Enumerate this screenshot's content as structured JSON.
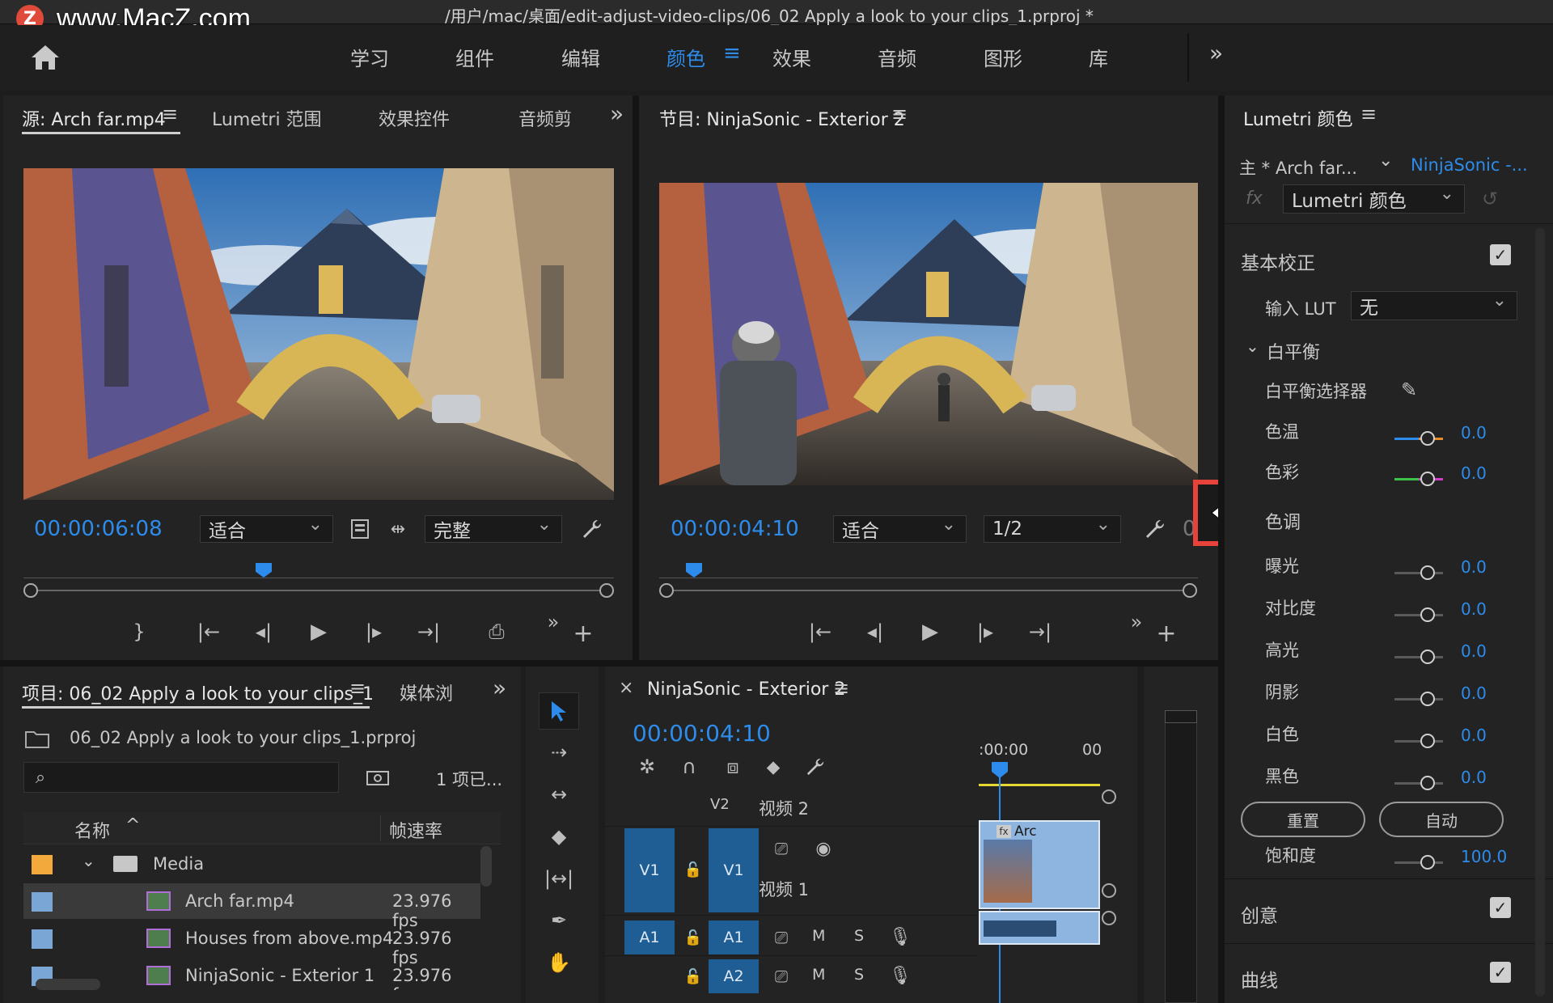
{
  "watermark": "www.MacZ.com",
  "window_title": "/用户/mac/桌面/edit-adjust-video-clips/06_02 Apply a look to your clips_1.prproj *",
  "workspaces": [
    "学习",
    "组件",
    "编辑",
    "颜色",
    "效果",
    "音频",
    "图形",
    "库"
  ],
  "active_workspace": "颜色",
  "source": {
    "tabs": [
      "源: Arch far.mp4",
      "Lumetri 范围",
      "效果控件",
      "音频剪"
    ],
    "timecode": "00:00:06:08",
    "fit": "适合",
    "quality": "完整"
  },
  "program": {
    "title": "节目: NinjaSonic - Exterior 2",
    "timecode": "00:00:04:10",
    "fit": "适合",
    "resolution": "1/2",
    "cut_text": "0"
  },
  "project": {
    "tabs": [
      "项目: 06_02 Apply a look to your clips_1",
      "媒体浏"
    ],
    "file": "06_02 Apply a look to your clips_1.prproj",
    "search_placeholder": "",
    "count": "1 项已...",
    "col_name": "名称",
    "col_fps": "帧速率",
    "folder": "Media",
    "items": [
      {
        "name": "Arch far.mp4",
        "fps": "23.976 fps",
        "color": "#7aa6d6"
      },
      {
        "name": "Houses from above.mp4",
        "fps": "23.976 fps",
        "color": "#7aa6d6"
      },
      {
        "name": "NinjaSonic - Exterior 1",
        "fps": "23.976 fps",
        "color": "#7aa6d6"
      }
    ]
  },
  "timeline": {
    "title": "NinjaSonic - Exterior 2",
    "close": "×",
    "timecode": "00:00:04:10",
    "ruler_start": ":00:00",
    "ruler_next": "00",
    "v2": "V2",
    "v2_name": "视频 2",
    "v1": "V1",
    "v1_name": "视频 1",
    "a1": "A1",
    "a2": "A2",
    "m": "M",
    "s": "S",
    "clip_label": "Arc"
  },
  "lumetri": {
    "title": "Lumetri 颜色",
    "master": "主 * Arch far...",
    "sequence": "NinjaSonic -...",
    "fx": "fx",
    "effect": "Lumetri 颜色",
    "basic": "基本校正",
    "input_lut_label": "输入 LUT",
    "input_lut_value": "无",
    "wb": "白平衡",
    "wb_picker": "白平衡选择器",
    "temp": "色温",
    "tint": "色彩",
    "tone": "色调",
    "params": [
      {
        "label": "曝光",
        "value": "0.0"
      },
      {
        "label": "对比度",
        "value": "0.0"
      },
      {
        "label": "高光",
        "value": "0.0"
      },
      {
        "label": "阴影",
        "value": "0.0"
      },
      {
        "label": "白色",
        "value": "0.0"
      },
      {
        "label": "黑色",
        "value": "0.0"
      }
    ],
    "temp_value": "0.0",
    "tint_value": "0.0",
    "reset": "重置",
    "auto": "自动",
    "saturation_label": "饱和度",
    "saturation_value": "100.0",
    "creative": "创意",
    "curves": "曲线",
    "accent": "#2d8ceb",
    "highlight_box": "#e8433a"
  }
}
